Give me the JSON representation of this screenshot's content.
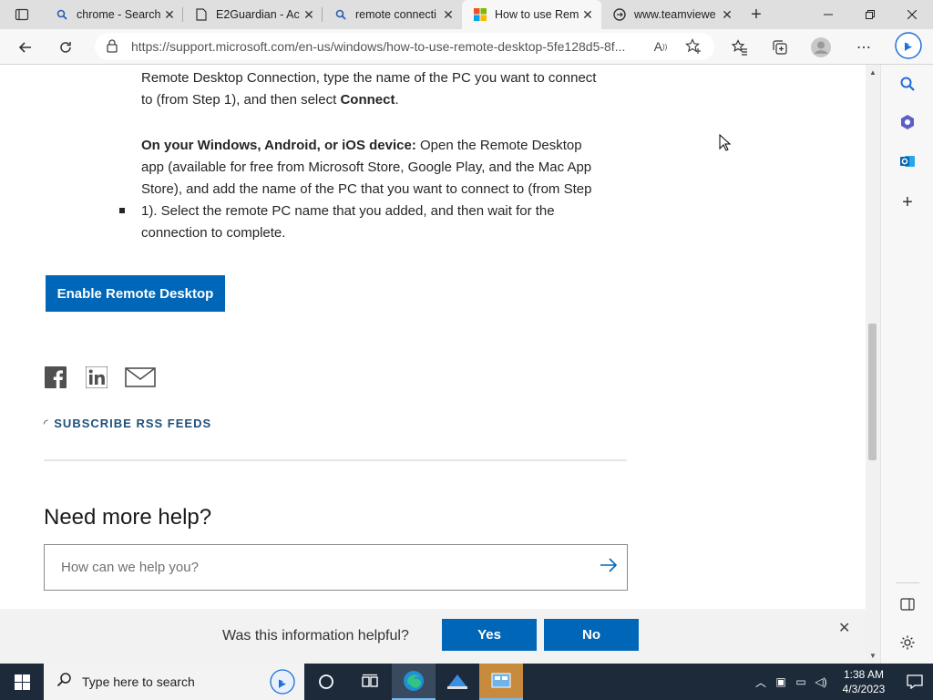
{
  "browser": {
    "tabs": [
      {
        "title": "chrome - Search",
        "favicon": "search-icon"
      },
      {
        "title": "E2Guardian - Ac",
        "favicon": "page-icon"
      },
      {
        "title": "remote connecti",
        "favicon": "search-icon"
      },
      {
        "title": "How to use Rem",
        "favicon": "microsoft-logo-icon",
        "active": true
      },
      {
        "title": "www.teamviewe",
        "favicon": "teamviewer-icon"
      }
    ],
    "url": "https://support.microsoft.com/en-us/windows/how-to-use-remote-desktop-5fe128d5-8f..."
  },
  "article": {
    "para1_line1": "Remote Desktop Connection, type the name of the PC you want to connect",
    "para1_line2_pre": "to (from Step 1), and then select ",
    "para1_line2_bold": "Connect",
    "para1_line2_post": ".",
    "bullet_bold": "On your Windows, Android, or iOS device:",
    "bullet_line1_rest": " Open the Remote Desktop",
    "bullet_line2": "app (available for free from Microsoft Store, Google Play, and the Mac App",
    "bullet_line3": "Store), and add the name of the PC that you want to connect to (from Step",
    "bullet_line4": "1).  Select the remote PC name that you added, and then wait for the",
    "bullet_line5": "connection to complete.",
    "enable_button": "Enable Remote Desktop"
  },
  "share": {
    "rss_label": "SUBSCRIBE RSS FEEDS"
  },
  "help": {
    "heading": "Need more help?",
    "placeholder": "How can we help you?"
  },
  "feedback": {
    "question": "Was this information helpful?",
    "yes": "Yes",
    "no": "No"
  },
  "taskbar": {
    "search_placeholder": "Type here to search",
    "time": "1:38 AM",
    "date": "4/3/2023"
  },
  "colors": {
    "accent": "#0067b8",
    "taskbar": "#1c2a3a"
  }
}
